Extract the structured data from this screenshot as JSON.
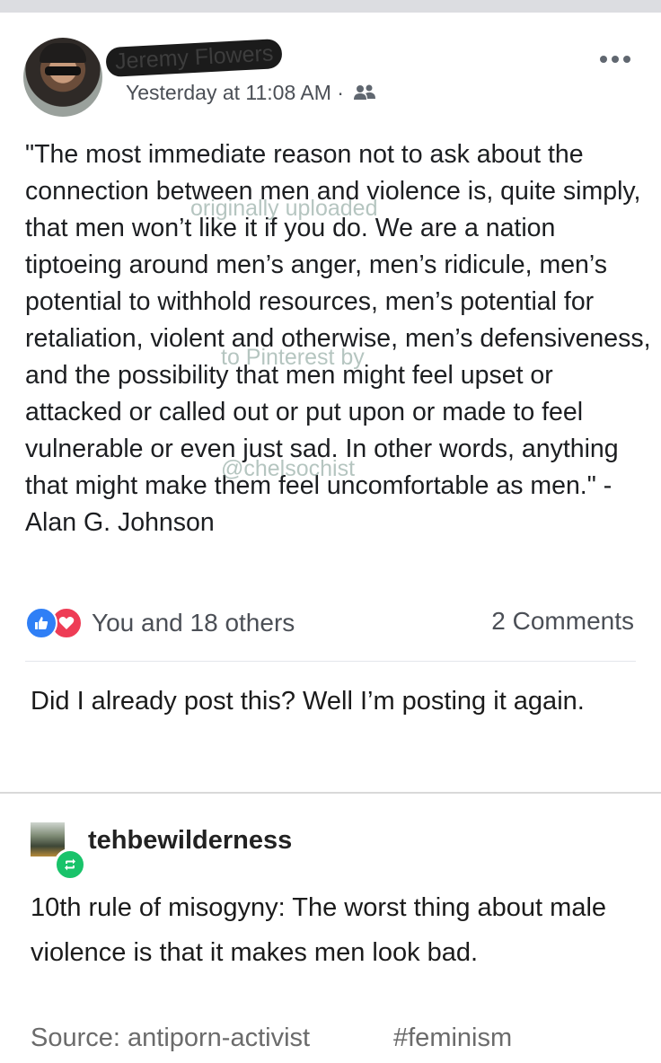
{
  "post": {
    "author": "Jeremy Flowers",
    "timestamp": "Yesterday at 11:08 AM",
    "separator": "·",
    "quote": "\"The most immediate reason not to ask about the connection between men and violence is, quite simply, that men won’t like it if you do. We are a nation tiptoeing around men’s anger, men’s ridicule, men’s potential to withhold resources, men’s potential for retaliation, violent and otherwise, men’s defensiveness, and the possibility that men might feel upset or attacked or called out or put upon or made to feel vulnerable or even just sad. In other words, anything that might make them feel uncomfortable as men.\" - Alan G. Johnson",
    "reactions_label": "You and 18 others",
    "comments_label": "2 Comments",
    "watermark": [
      "originally uploaded",
      "to Pinterest by",
      "@chelsochist"
    ]
  },
  "reblog_comment": "Did I already post this? Well I’m posting it again.",
  "reblog": {
    "username": "tehbewilderness",
    "body": "10th rule of misogyny: The worst thing about male violence is that it makes men look bad."
  },
  "footer": {
    "source_prefix": "Source: ",
    "source_user": "antiporn-activist",
    "tag": "#feminism"
  },
  "colors": {
    "like": "#2f7ff6",
    "love": "#ee3c55",
    "reblog": "#19c36a"
  }
}
